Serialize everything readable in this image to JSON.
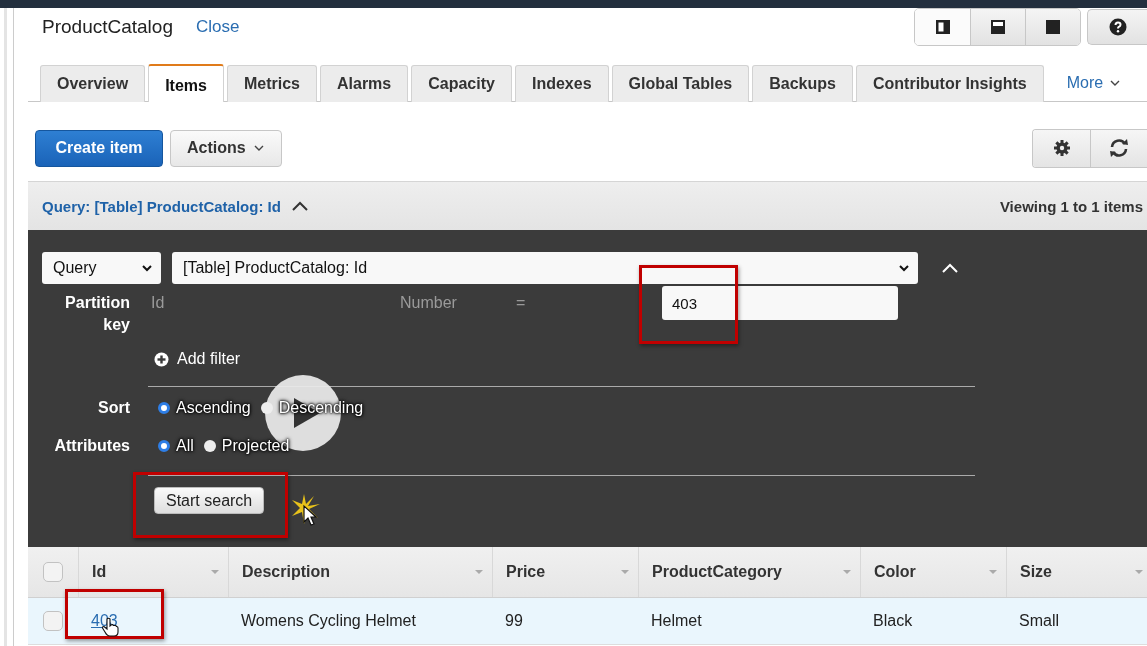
{
  "header": {
    "title": "ProductCatalog",
    "close": "Close"
  },
  "view_buttons": [
    {
      "kind": "left",
      "selected": true
    },
    {
      "kind": "bottom",
      "selected": false
    },
    {
      "kind": "full",
      "selected": false
    }
  ],
  "tabs": [
    {
      "label": "Overview",
      "selected": false
    },
    {
      "label": "Items",
      "selected": true
    },
    {
      "label": "Metrics",
      "selected": false
    },
    {
      "label": "Alarms",
      "selected": false
    },
    {
      "label": "Capacity",
      "selected": false
    },
    {
      "label": "Indexes",
      "selected": false
    },
    {
      "label": "Global Tables",
      "selected": false
    },
    {
      "label": "Backups",
      "selected": false
    },
    {
      "label": "Contributor Insights",
      "selected": false
    }
  ],
  "more_tab": "More",
  "toolbar": {
    "create": "Create item",
    "actions": "Actions"
  },
  "query_bar": {
    "title": "Query: [Table] ProductCatalog: Id",
    "viewing": "Viewing 1 to 1 items"
  },
  "query": {
    "operation": "Query",
    "index": "[Table] ProductCatalog: Id",
    "partition_label": "Partition key",
    "key_name": "Id",
    "key_type": "Number",
    "operator": "=",
    "value": "403",
    "add_filter": "Add filter",
    "sort_label": "Sort",
    "sort_options": [
      {
        "label": "Ascending",
        "selected": true
      },
      {
        "label": "Descending",
        "selected": false
      }
    ],
    "attributes_label": "Attributes",
    "attribute_options": [
      {
        "label": "All",
        "selected": true
      },
      {
        "label": "Projected",
        "selected": false
      }
    ],
    "start_search": "Start search"
  },
  "table": {
    "all_checked": false,
    "columns": [
      "Id",
      "Description",
      "Price",
      "ProductCategory",
      "Color",
      "Size"
    ],
    "rows": [
      {
        "checked": false,
        "highlighted": true,
        "cells": [
          "403",
          "Womens Cycling Helmet",
          "99",
          "Helmet",
          "Black",
          "Small"
        ]
      }
    ]
  }
}
